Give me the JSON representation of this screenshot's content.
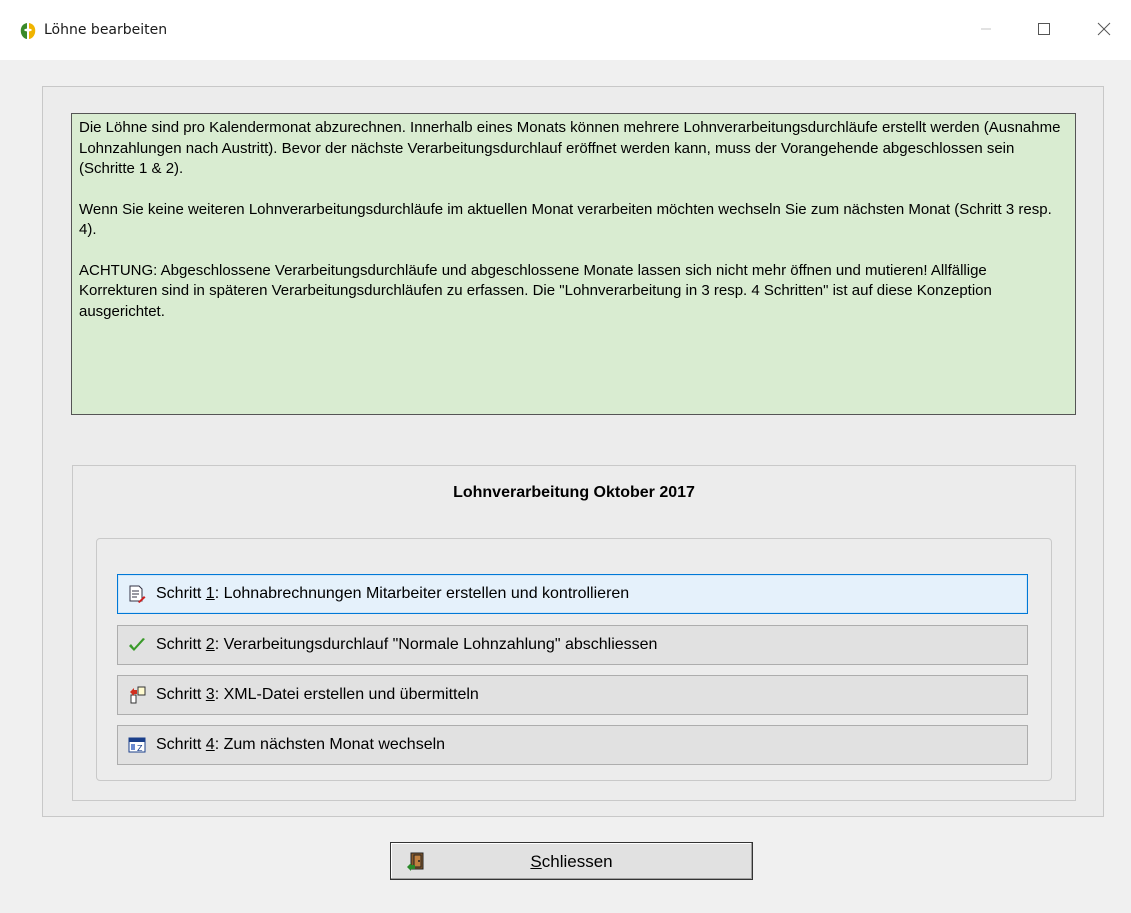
{
  "window": {
    "title": "Löhne bearbeiten"
  },
  "info": {
    "paragraph1": "Die Löhne sind pro Kalendermonat abzurechnen. Innerhalb eines Monats können mehrere Lohnverarbeitungsdurchläufe erstellt werden (Ausnahme Lohnzahlungen nach Austritt). Bevor der nächste Verarbeitungsdurchlauf eröffnet werden kann, muss der Vorangehende abgeschlossen sein (Schritte 1 & 2).",
    "paragraph2": "Wenn Sie keine weiteren Lohnverarbeitungsdurchläufe im aktuellen Monat verarbeiten möchten wechseln Sie zum nächsten Monat  (Schritt 3 resp. 4).",
    "paragraph3": "ACHTUNG: Abgeschlossene Verarbeitungsdurchläufe und abgeschlossene Monate lassen sich nicht mehr öffnen und mutieren! Allfällige Korrekturen sind in späteren Verarbeitungsdurchläufen zu erfassen. Die \"Lohnverarbeitung in 3 resp. 4 Schritten\" ist auf diese Konzeption ausgerichtet."
  },
  "process": {
    "title": "Lohnverarbeitung Oktober 2017",
    "steps": [
      {
        "prefix": "Schritt ",
        "num": "1",
        "text": ": Lohnabrechnungen Mitarbeiter erstellen und kontrollieren",
        "icon": "report-edit-icon"
      },
      {
        "prefix": "Schritt ",
        "num": "2",
        "text": ": Verarbeitungsdurchlauf \"Normale Lohnzahlung\" abschliessen",
        "icon": "checkmark-icon"
      },
      {
        "prefix": "Schritt ",
        "num": "3",
        "text": ": XML-Datei erstellen und übermitteln",
        "icon": "xml-transfer-icon"
      },
      {
        "prefix": "Schritt ",
        "num": "4",
        "text": ": Zum nächsten Monat wechseln",
        "icon": "calendar-icon"
      }
    ]
  },
  "close": {
    "label_access": "S",
    "label_rest": "chliessen",
    "icon": "exit-door-icon"
  },
  "colors": {
    "info_bg": "#d9ecd1",
    "focus_border": "#0078d7",
    "check_green": "#3a9a2a"
  }
}
